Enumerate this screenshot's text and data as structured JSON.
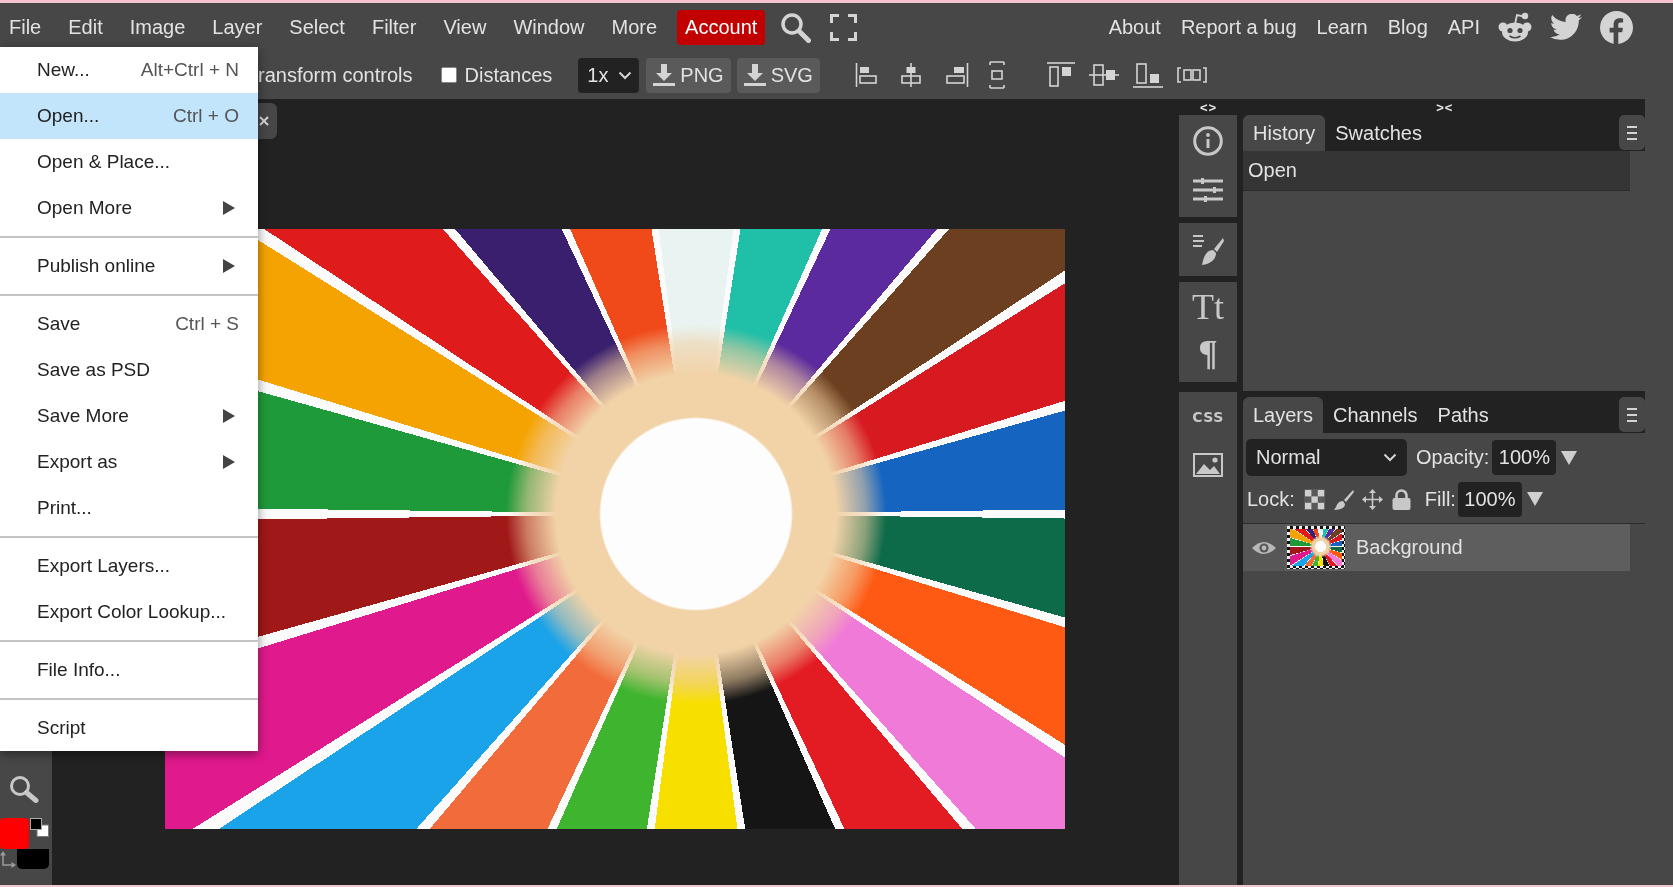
{
  "menu_bar": {
    "items": [
      "File",
      "Edit",
      "Image",
      "Layer",
      "Select",
      "Filter",
      "View",
      "Window",
      "More"
    ],
    "account": "Account",
    "links": [
      "About",
      "Report a bug",
      "Learn",
      "Blog",
      "API"
    ]
  },
  "toolbar": {
    "transform_controls_label": "ransform controls",
    "distances": {
      "label": "Distances",
      "checked": false
    },
    "scale": "1x",
    "export_buttons": [
      "PNG",
      "SVG"
    ]
  },
  "file_menu": [
    {
      "kind": "item",
      "label": "New...",
      "shortcut": "Alt+Ctrl + N",
      "selected": false
    },
    {
      "kind": "item",
      "label": "Open...",
      "shortcut": "Ctrl + O",
      "selected": true
    },
    {
      "kind": "item",
      "label": "Open & Place...",
      "selected": false
    },
    {
      "kind": "submenu",
      "label": "Open More",
      "selected": false
    },
    {
      "kind": "separator"
    },
    {
      "kind": "submenu",
      "label": "Publish online",
      "selected": false
    },
    {
      "kind": "separator"
    },
    {
      "kind": "item",
      "label": "Save",
      "shortcut": "Ctrl + S",
      "selected": false
    },
    {
      "kind": "item",
      "label": "Save as PSD",
      "selected": false
    },
    {
      "kind": "submenu",
      "label": "Save More",
      "selected": false
    },
    {
      "kind": "submenu",
      "label": "Export as",
      "selected": false
    },
    {
      "kind": "item",
      "label": "Print...",
      "selected": false
    },
    {
      "kind": "separator"
    },
    {
      "kind": "item",
      "label": "Export Layers...",
      "selected": false
    },
    {
      "kind": "item",
      "label": "Export Color Lookup...",
      "selected": false
    },
    {
      "kind": "separator"
    },
    {
      "kind": "item",
      "label": "File Info...",
      "selected": false
    },
    {
      "kind": "separator"
    },
    {
      "kind": "item",
      "label": "Script",
      "selected": false
    }
  ],
  "tool_colors": [
    {
      "kind": "foreground",
      "color": "#ff0000"
    },
    {
      "kind": "background",
      "color": "#000000"
    }
  ],
  "dock": {
    "expand_toggle": "<>",
    "collapse_toggle": "><",
    "glyph_buttons": [
      "Tt",
      "¶",
      "CSS"
    ]
  },
  "history_panel": {
    "tabs": [
      {
        "label": "History",
        "selected": true
      },
      {
        "label": "Swatches",
        "selected": false
      }
    ],
    "states": [
      {
        "label": "Open",
        "selected": true
      }
    ]
  },
  "layers_panel": {
    "tabs": [
      {
        "label": "Layers",
        "selected": true
      },
      {
        "label": "Channels",
        "selected": false
      },
      {
        "label": "Paths",
        "selected": false
      }
    ],
    "blend_mode": "Normal",
    "opacity_label": "Opacity:",
    "opacity": "100%",
    "lock_label": "Lock:",
    "fill_label": "Fill:",
    "fill": "100%",
    "layers": [
      {
        "name": "Background",
        "visible": true,
        "selected": true
      }
    ]
  }
}
